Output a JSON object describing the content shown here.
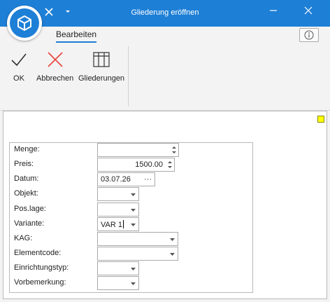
{
  "window": {
    "title": "Gliederung eröffnen"
  },
  "ribbon": {
    "tab_label": "Bearbeiten",
    "buttons": {
      "ok": "OK",
      "cancel": "Abbrechen",
      "outlines": "Gliederungen"
    }
  },
  "form": {
    "menge": {
      "label": "Menge:",
      "value": ""
    },
    "preis": {
      "label": "Preis:",
      "value": "1500.00"
    },
    "datum": {
      "label": "Datum:",
      "value": "03.07.26"
    },
    "objekt": {
      "label": "Objekt:",
      "value": ""
    },
    "poslage": {
      "label": "Pos.lage:",
      "value": ""
    },
    "variante": {
      "label": "Variante:",
      "value": "VAR 1"
    },
    "kag": {
      "label": "KAG:",
      "value": ""
    },
    "elementcode": {
      "label": "Elementcode:",
      "value": ""
    },
    "einrichtungstyp": {
      "label": "Einrichtungstyp:",
      "value": ""
    },
    "vorbemerkung": {
      "label": "Vorbemerkung:",
      "value": ""
    }
  },
  "colors": {
    "titlebar": "#1e7fd6",
    "cancel_icon": "#e8453c",
    "marker": "#ffff00"
  }
}
